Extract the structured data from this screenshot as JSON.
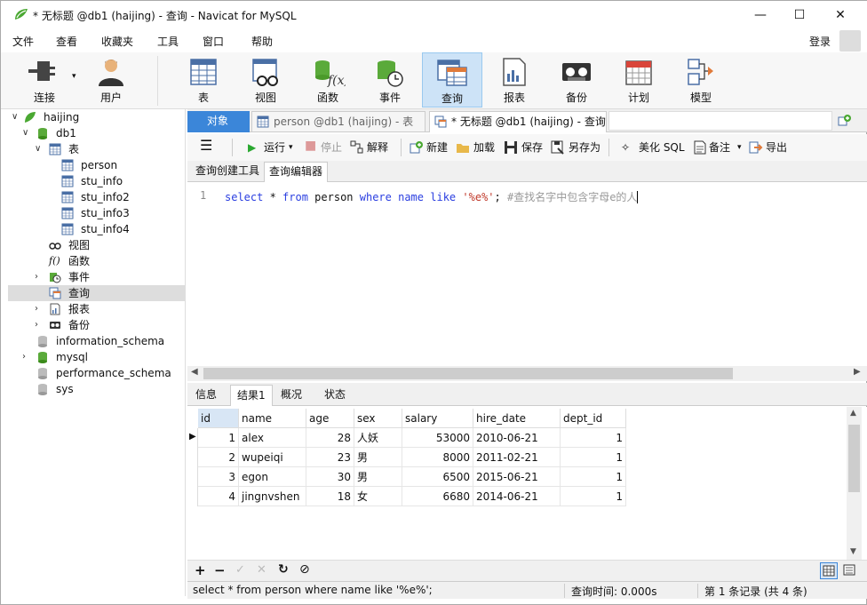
{
  "window": {
    "title": "* 无标题 @db1 (haijing) - 查询 - Navicat for MySQL",
    "minimize": "—",
    "maximize": "☐",
    "close": "✕"
  },
  "menu": {
    "items": [
      "文件",
      "查看",
      "收藏夹",
      "工具",
      "窗口",
      "帮助"
    ],
    "login": "登录"
  },
  "toolbar": {
    "items": [
      {
        "label": "连接",
        "icon": "connection-icon"
      },
      {
        "label": "用户",
        "icon": "user-icon"
      },
      {
        "label": "表",
        "icon": "table-icon"
      },
      {
        "label": "视图",
        "icon": "view-icon"
      },
      {
        "label": "函数",
        "icon": "function-icon"
      },
      {
        "label": "事件",
        "icon": "event-icon"
      },
      {
        "label": "查询",
        "icon": "query-icon"
      },
      {
        "label": "报表",
        "icon": "report-icon"
      },
      {
        "label": "备份",
        "icon": "backup-icon"
      },
      {
        "label": "计划",
        "icon": "schedule-icon"
      },
      {
        "label": "模型",
        "icon": "model-icon"
      }
    ],
    "active": "查询"
  },
  "tree": {
    "connection": "haijing",
    "database": "db1",
    "tables_node": "表",
    "tables": [
      "person",
      "stu_info",
      "stu_info2",
      "stu_info3",
      "stu_info4"
    ],
    "view_node": "视图",
    "function_node": "函数",
    "event_node": "事件",
    "query_node": "查询",
    "report_node": "报表",
    "backup_node": "备份",
    "other_dbs": [
      "information_schema",
      "mysql",
      "performance_schema",
      "sys"
    ]
  },
  "tabs": {
    "objects": "对象",
    "person_tab": "person @db1 (haijing) - 表",
    "query_tab": "* 无标题 @db1 (haijing) - 查询"
  },
  "editor_toolbar": {
    "run": "运行",
    "stop": "停止",
    "explain": "解释",
    "new": "新建",
    "load": "加载",
    "save": "保存",
    "save_as": "另存为",
    "beautify": "美化 SQL",
    "note": "备注",
    "export": "导出"
  },
  "subtabs": {
    "builder": "查询创建工具",
    "editor": "查询编辑器"
  },
  "sql": {
    "line_number": "1",
    "t1": "select",
    "t2": " * ",
    "t3": "from",
    "t4": " person ",
    "t5": "where",
    "t6": " ",
    "t7": "name",
    "t8": " ",
    "t9": "like",
    "t10": " ",
    "t11": "'%e%'",
    "t12": "; ",
    "t13": "#查找名字中包含字母e的人"
  },
  "result_tabs": [
    "信息",
    "结果1",
    "概况",
    "状态"
  ],
  "result_active": "结果1",
  "grid": {
    "columns": [
      "id",
      "name",
      "age",
      "sex",
      "salary",
      "hire_date",
      "dept_id"
    ],
    "rows": [
      [
        "1",
        "alex",
        "28",
        "人妖",
        "53000",
        "2010-06-21",
        "1"
      ],
      [
        "2",
        "wupeiqi",
        "23",
        "男",
        "8000",
        "2011-02-21",
        "1"
      ],
      [
        "3",
        "egon",
        "30",
        "男",
        "6500",
        "2015-06-21",
        "1"
      ],
      [
        "4",
        "jingnvshen",
        "18",
        "女",
        "6680",
        "2014-06-21",
        "1"
      ]
    ]
  },
  "navbar": {
    "add": "+",
    "remove": "−",
    "apply": "✓",
    "cancel": "✕",
    "refresh": "↻",
    "stop": "⊘"
  },
  "status": {
    "sql": "select * from person where name like '%e%';",
    "time": "查询时间: 0.000s",
    "records": "第 1 条记录 (共 4 条)"
  },
  "colors": {
    "accent": "#2a3ee0",
    "active_toolbar": "#cde3f7",
    "string": "#c0392b",
    "comment": "#999999"
  }
}
